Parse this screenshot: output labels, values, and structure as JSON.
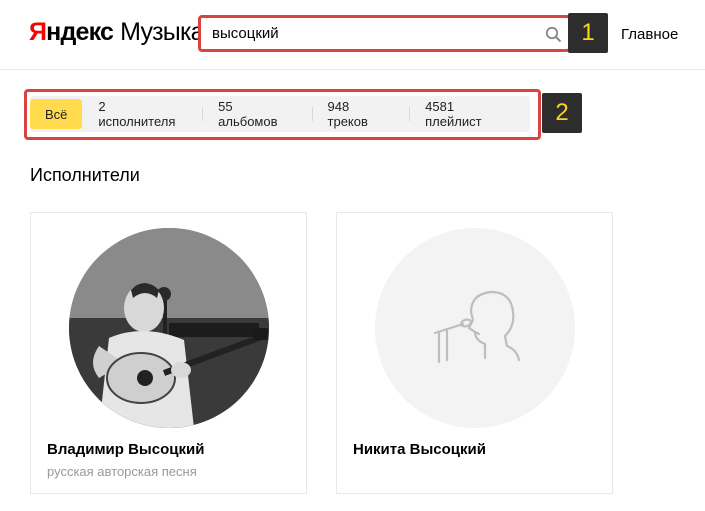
{
  "logo": {
    "brand": "Яндекс",
    "product": "Музыка"
  },
  "search": {
    "value": "высоцкий"
  },
  "nav": {
    "home": "Главное"
  },
  "badges": [
    "1",
    "2"
  ],
  "tabs": [
    {
      "label": "Всё",
      "active": true
    },
    {
      "label": "2 исполнителя",
      "active": false
    },
    {
      "label": "55 альбомов",
      "active": false
    },
    {
      "label": "948 треков",
      "active": false
    },
    {
      "label": "4581 плейлист",
      "active": false
    }
  ],
  "section": {
    "title": "Исполнители"
  },
  "artists": [
    {
      "name": "Владимир Высоцкий",
      "genre": "русская авторская песня",
      "avatar": "photo"
    },
    {
      "name": "Никита Высоцкий",
      "genre": "",
      "avatar": "placeholder-singer-icon"
    }
  ],
  "colors": {
    "accent": "#ffdb4d",
    "highlight": "#d9443f",
    "logo_red": "#ff0000"
  }
}
